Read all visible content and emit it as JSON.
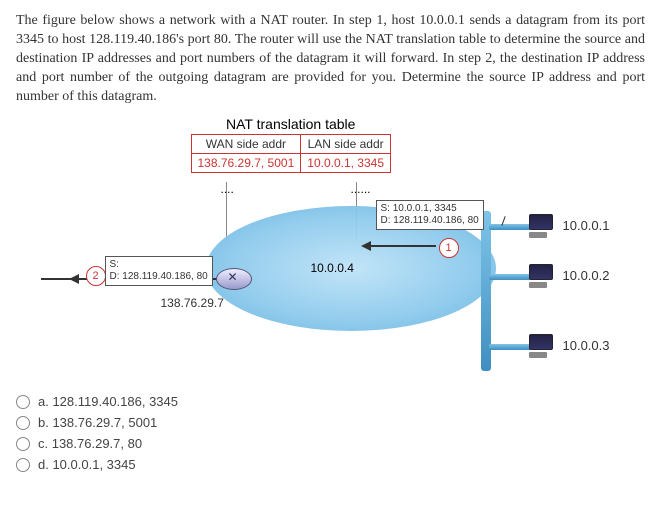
{
  "question": "The figure below shows a network with a NAT router. In step 1, host 10.0.0.1 sends a datagram from its port 3345 to host 128.119.40.186's port 80. The router will use the NAT translation table to determine the source and destination IP addresses and port numbers of the datagram it will forward. In step 2, the destination IP address and port number of the outgoing datagram are provided for you. Determine the source IP address and port number of this datagram.",
  "nat_table": {
    "caption": "NAT translation table",
    "col_wan": "WAN side addr",
    "col_lan": "LAN side addr",
    "val_wan": "138.76.29.7, 5001",
    "val_lan": "10.0.0.1, 3345"
  },
  "dots": "....",
  "dots2": "......",
  "router": {
    "wan_ip": "138.76.29.7",
    "lan_ip": "10.0.0.4"
  },
  "hosts": {
    "h1": "10.0.0.1",
    "h2": "10.0.0.2",
    "h3": "10.0.0.3"
  },
  "markers": {
    "m1": "1",
    "m2": "2"
  },
  "packets": {
    "p1_src": "S: 10.0.0.1, 3345",
    "p1_dst": "D: 128.119.40.186, 80",
    "p2_src": "S:",
    "p2_dst": "D: 128.119.40.186, 80"
  },
  "options": {
    "a": "a. 128.119.40.186, 3345",
    "b": "b. 138.76.29.7, 5001",
    "c": "c. 138.76.29.7, 80",
    "d": "d. 10.0.0.1, 3345"
  }
}
